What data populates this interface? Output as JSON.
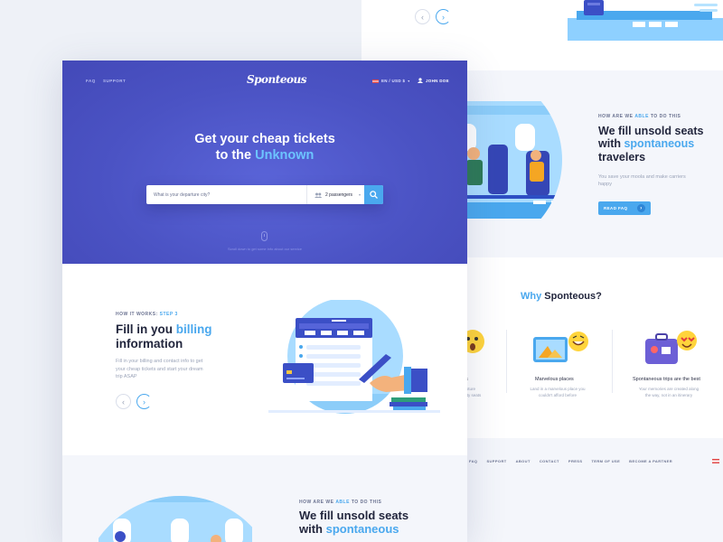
{
  "main": {
    "nav": {
      "faq": "FAQ",
      "support": "SUPPORT",
      "lang": "EN / USD $",
      "user": "JOHN DOE"
    },
    "logo": "Sponteous",
    "hero": {
      "title_line1": "Get your cheap tickets",
      "title_line2_prefix": "to the ",
      "title_line2_accent": "Unknown",
      "search_placeholder": "What is your departure city?",
      "passengers": "2 passengers",
      "scroll_hint": "Scroll down to get some info about our service"
    },
    "how": {
      "eyebrow": "HOW IT WORKS:",
      "eyebrow_step": "STEP 3",
      "title_prefix": "Fill in you ",
      "title_accent": "billing",
      "title_line2": "information",
      "body": "Fill in your billing and contact info to get your cheap tickets and start your dream trip ASAP"
    },
    "fill": {
      "eyebrow_a": "HOW ARE WE ",
      "eyebrow_b": "ABLE",
      "eyebrow_c": " TO DO THIS",
      "title_line1": "We fill unsold seats",
      "title_line2_prefix": "with ",
      "title_line2_accent": "spontaneous"
    }
  },
  "bg": {
    "fill": {
      "eyebrow_a": "HOW ARE WE ",
      "eyebrow_b": "ABLE",
      "eyebrow_c": " TO DO THIS",
      "title_line1": "We fill unsold seats",
      "title_line2_prefix": "with ",
      "title_line2_accent": "spontaneous",
      "title_line3": "travelers",
      "body": "You save your moola and make carriers happy",
      "button": "READ FAQ"
    },
    "why": {
      "title_accent": "Why",
      "title_rest": " Sponteous?",
      "card0_label": "s",
      "card0_desc_a": "...pture",
      "card0_desc_b": "...ity seats",
      "card1_label": "Marvelous places",
      "card1_desc": "Land in a marvelous place you couldn't afford before",
      "card2_label": "Spontaneous trips are the best",
      "card2_desc": "Your memories are created along the way, not in an itinerary"
    },
    "footer": [
      "FAQ",
      "SUPPORT",
      "ABOUT",
      "CONTACT",
      "PRESS",
      "TERM OF USE",
      "BECOME A PARTNER"
    ]
  },
  "colors": {
    "accent": "#4aa8ee",
    "hero": "#4b53c4",
    "dark": "#22263d"
  }
}
